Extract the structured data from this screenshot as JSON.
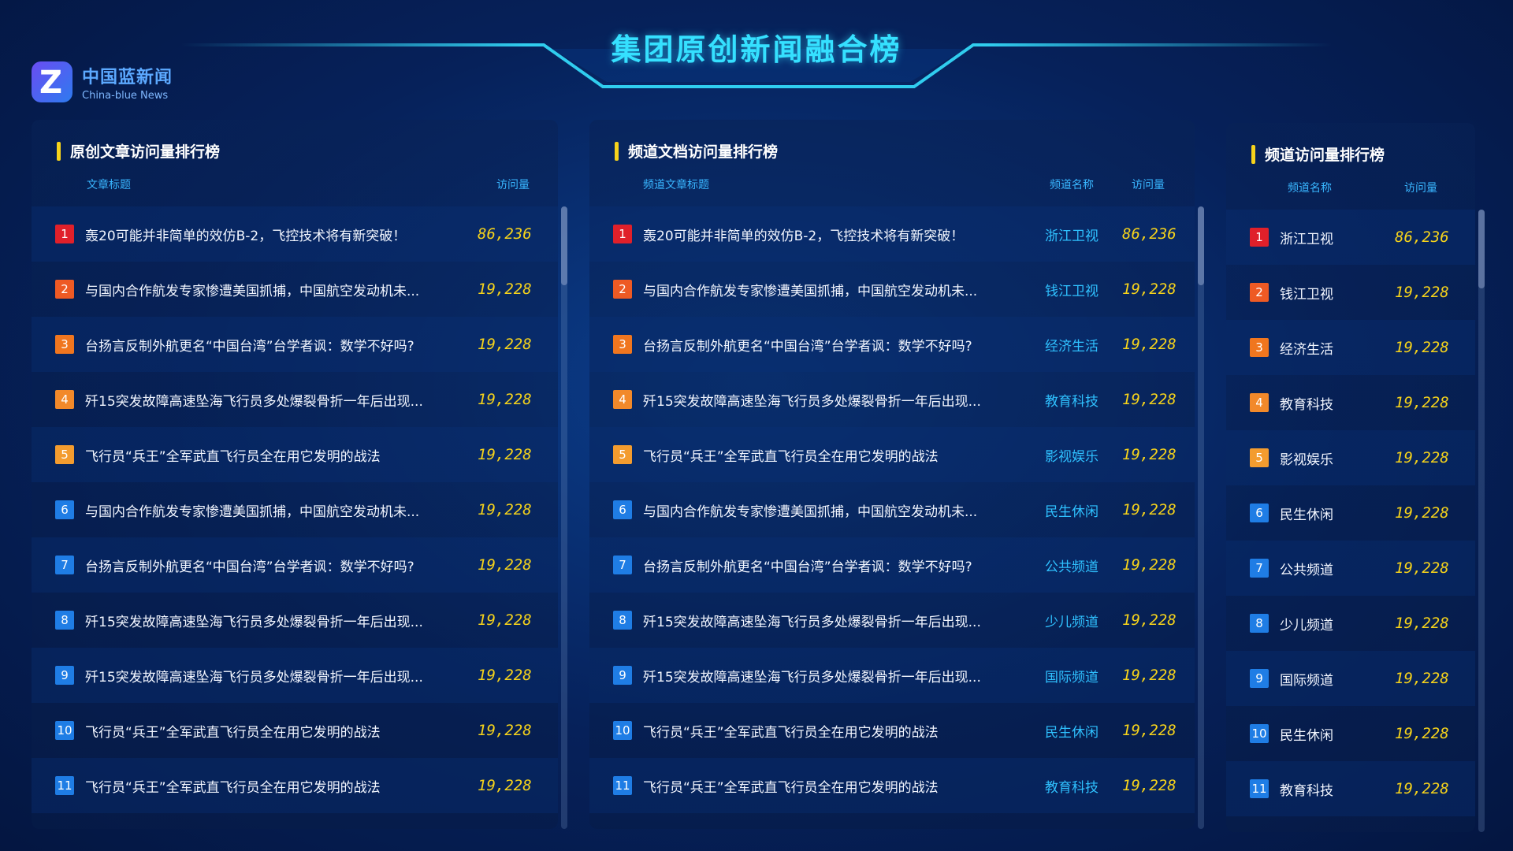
{
  "header": {
    "title": "集团原创新闻融合榜",
    "logo_cn": "中国蓝新闻",
    "logo_en": "China-blue News"
  },
  "colors": {
    "accent": "#35e0ff",
    "value": "#f6d31b",
    "channel": "#2fc1ff",
    "rank_top": "#e0202a",
    "rank_normal": "#1f7de5"
  },
  "panel1": {
    "title": "原创文章访问量排行榜",
    "col_title": "文章标题",
    "col_visits": "访问量",
    "rows": [
      {
        "rank": "1",
        "title": "轰20可能并非简单的效仿B-2，飞控技术将有新突破！",
        "visits": "86,236"
      },
      {
        "rank": "2",
        "title": "与国内合作航发专家惨遭美国抓捕，中国航空发动机未...",
        "visits": "19,228"
      },
      {
        "rank": "3",
        "title": "台扬言反制外航更名“中国台湾”台学者讽：数学不好吗?",
        "visits": "19,228"
      },
      {
        "rank": "4",
        "title": "歼15突发故障高速坠海飞行员多处爆裂骨折一年后出现...",
        "visits": "19,228"
      },
      {
        "rank": "5",
        "title": "飞行员“兵王”全军武直飞行员全在用它发明的战法",
        "visits": "19,228"
      },
      {
        "rank": "6",
        "title": "与国内合作航发专家惨遭美国抓捕，中国航空发动机未...",
        "visits": "19,228"
      },
      {
        "rank": "7",
        "title": "台扬言反制外航更名“中国台湾”台学者讽：数学不好吗?",
        "visits": "19,228"
      },
      {
        "rank": "8",
        "title": "歼15突发故障高速坠海飞行员多处爆裂骨折一年后出现...",
        "visits": "19,228"
      },
      {
        "rank": "9",
        "title": "歼15突发故障高速坠海飞行员多处爆裂骨折一年后出现...",
        "visits": "19,228"
      },
      {
        "rank": "10",
        "title": "飞行员“兵王”全军武直飞行员全在用它发明的战法",
        "visits": "19,228"
      },
      {
        "rank": "11",
        "title": "飞行员“兵王”全军武直飞行员全在用它发明的战法",
        "visits": "19,228"
      }
    ]
  },
  "panel2": {
    "title": "频道文档访问量排行榜",
    "col_title": "频道文章标题",
    "col_channel": "频道名称",
    "col_visits": "访问量",
    "rows": [
      {
        "rank": "1",
        "title": "轰20可能并非简单的效仿B-2，飞控技术将有新突破！",
        "channel": "浙江卫视",
        "visits": "86,236"
      },
      {
        "rank": "2",
        "title": "与国内合作航发专家惨遭美国抓捕，中国航空发动机未...",
        "channel": "钱江卫视",
        "visits": "19,228"
      },
      {
        "rank": "3",
        "title": "台扬言反制外航更名“中国台湾”台学者讽：数学不好吗?",
        "channel": "经济生活",
        "visits": "19,228"
      },
      {
        "rank": "4",
        "title": "歼15突发故障高速坠海飞行员多处爆裂骨折一年后出现...",
        "channel": "教育科技",
        "visits": "19,228"
      },
      {
        "rank": "5",
        "title": "飞行员“兵王”全军武直飞行员全在用它发明的战法",
        "channel": "影视娱乐",
        "visits": "19,228"
      },
      {
        "rank": "6",
        "title": "与国内合作航发专家惨遭美国抓捕，中国航空发动机未...",
        "channel": "民生休闲",
        "visits": "19,228"
      },
      {
        "rank": "7",
        "title": "台扬言反制外航更名“中国台湾”台学者讽：数学不好吗?",
        "channel": "公共频道",
        "visits": "19,228"
      },
      {
        "rank": "8",
        "title": "歼15突发故障高速坠海飞行员多处爆裂骨折一年后出现...",
        "channel": "少儿频道",
        "visits": "19,228"
      },
      {
        "rank": "9",
        "title": "歼15突发故障高速坠海飞行员多处爆裂骨折一年后出现...",
        "channel": "国际频道",
        "visits": "19,228"
      },
      {
        "rank": "10",
        "title": "飞行员“兵王”全军武直飞行员全在用它发明的战法",
        "channel": "民生休闲",
        "visits": "19,228"
      },
      {
        "rank": "11",
        "title": "飞行员“兵王”全军武直飞行员全在用它发明的战法",
        "channel": "教育科技",
        "visits": "19,228"
      }
    ]
  },
  "panel3": {
    "title": "频道访问量排行榜",
    "col_channel": "频道名称",
    "col_visits": "访问量",
    "rows": [
      {
        "rank": "1",
        "channel": "浙江卫视",
        "visits": "86,236"
      },
      {
        "rank": "2",
        "channel": "钱江卫视",
        "visits": "19,228"
      },
      {
        "rank": "3",
        "channel": "经济生活",
        "visits": "19,228"
      },
      {
        "rank": "4",
        "channel": "教育科技",
        "visits": "19,228"
      },
      {
        "rank": "5",
        "channel": "影视娱乐",
        "visits": "19,228"
      },
      {
        "rank": "6",
        "channel": "民生休闲",
        "visits": "19,228"
      },
      {
        "rank": "7",
        "channel": "公共频道",
        "visits": "19,228"
      },
      {
        "rank": "8",
        "channel": "少儿频道",
        "visits": "19,228"
      },
      {
        "rank": "9",
        "channel": "国际频道",
        "visits": "19,228"
      },
      {
        "rank": "10",
        "channel": "民生休闲",
        "visits": "19,228"
      },
      {
        "rank": "11",
        "channel": "教育科技",
        "visits": "19,228"
      }
    ]
  }
}
